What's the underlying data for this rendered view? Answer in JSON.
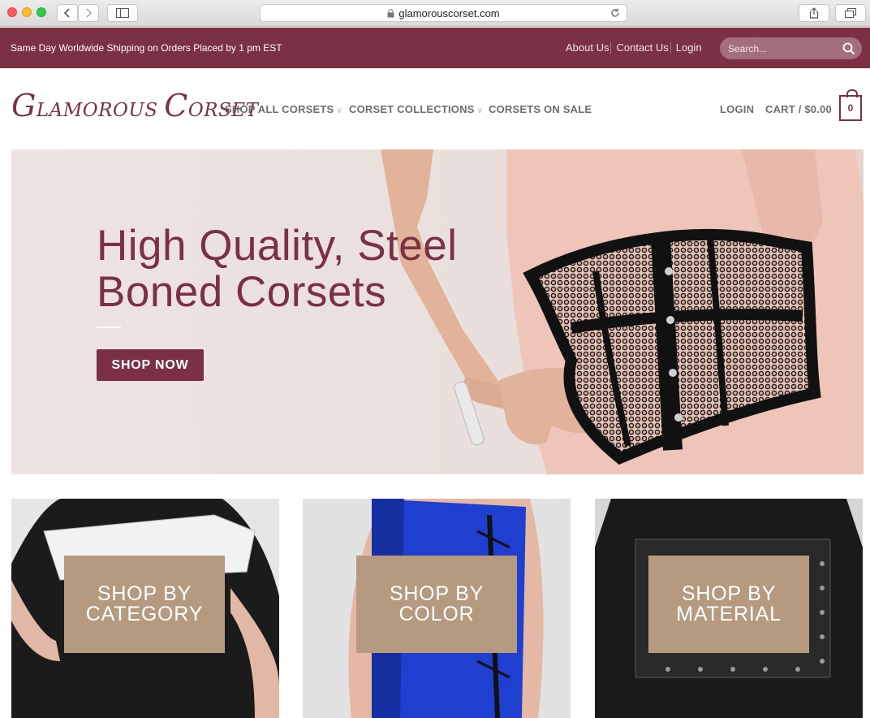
{
  "browser": {
    "url": "glamorouscorset.com"
  },
  "topbar": {
    "shipping": "Same Day Worldwide Shipping on Orders Placed by 1 pm EST",
    "links": [
      "About Us",
      "Contact Us",
      "Login"
    ],
    "search_placeholder": "Search..."
  },
  "header": {
    "logo": {
      "g": "G",
      "lamorous": "LAMOROUS",
      "c": "C",
      "orset": "ORSET"
    },
    "nav": [
      "SHOP ALL CORSETS",
      "CORSET COLLECTIONS",
      "CORSETS ON SALE"
    ],
    "login": "LOGIN",
    "cart": "CART / $0.00",
    "cart_count": "0"
  },
  "hero": {
    "title_line1": "High Quality, Steel",
    "title_line2": "Boned Corsets",
    "button": "SHOP NOW"
  },
  "tiles": [
    {
      "line1": "SHOP BY",
      "line2": "CATEGORY"
    },
    {
      "line1": "SHOP BY",
      "line2": "COLOR"
    },
    {
      "line1": "SHOP BY",
      "line2": "MATERIAL"
    }
  ],
  "colors": {
    "brand": "#7b3143",
    "tile_box": "#b69a80",
    "hero_bg": "#ede4e2"
  }
}
